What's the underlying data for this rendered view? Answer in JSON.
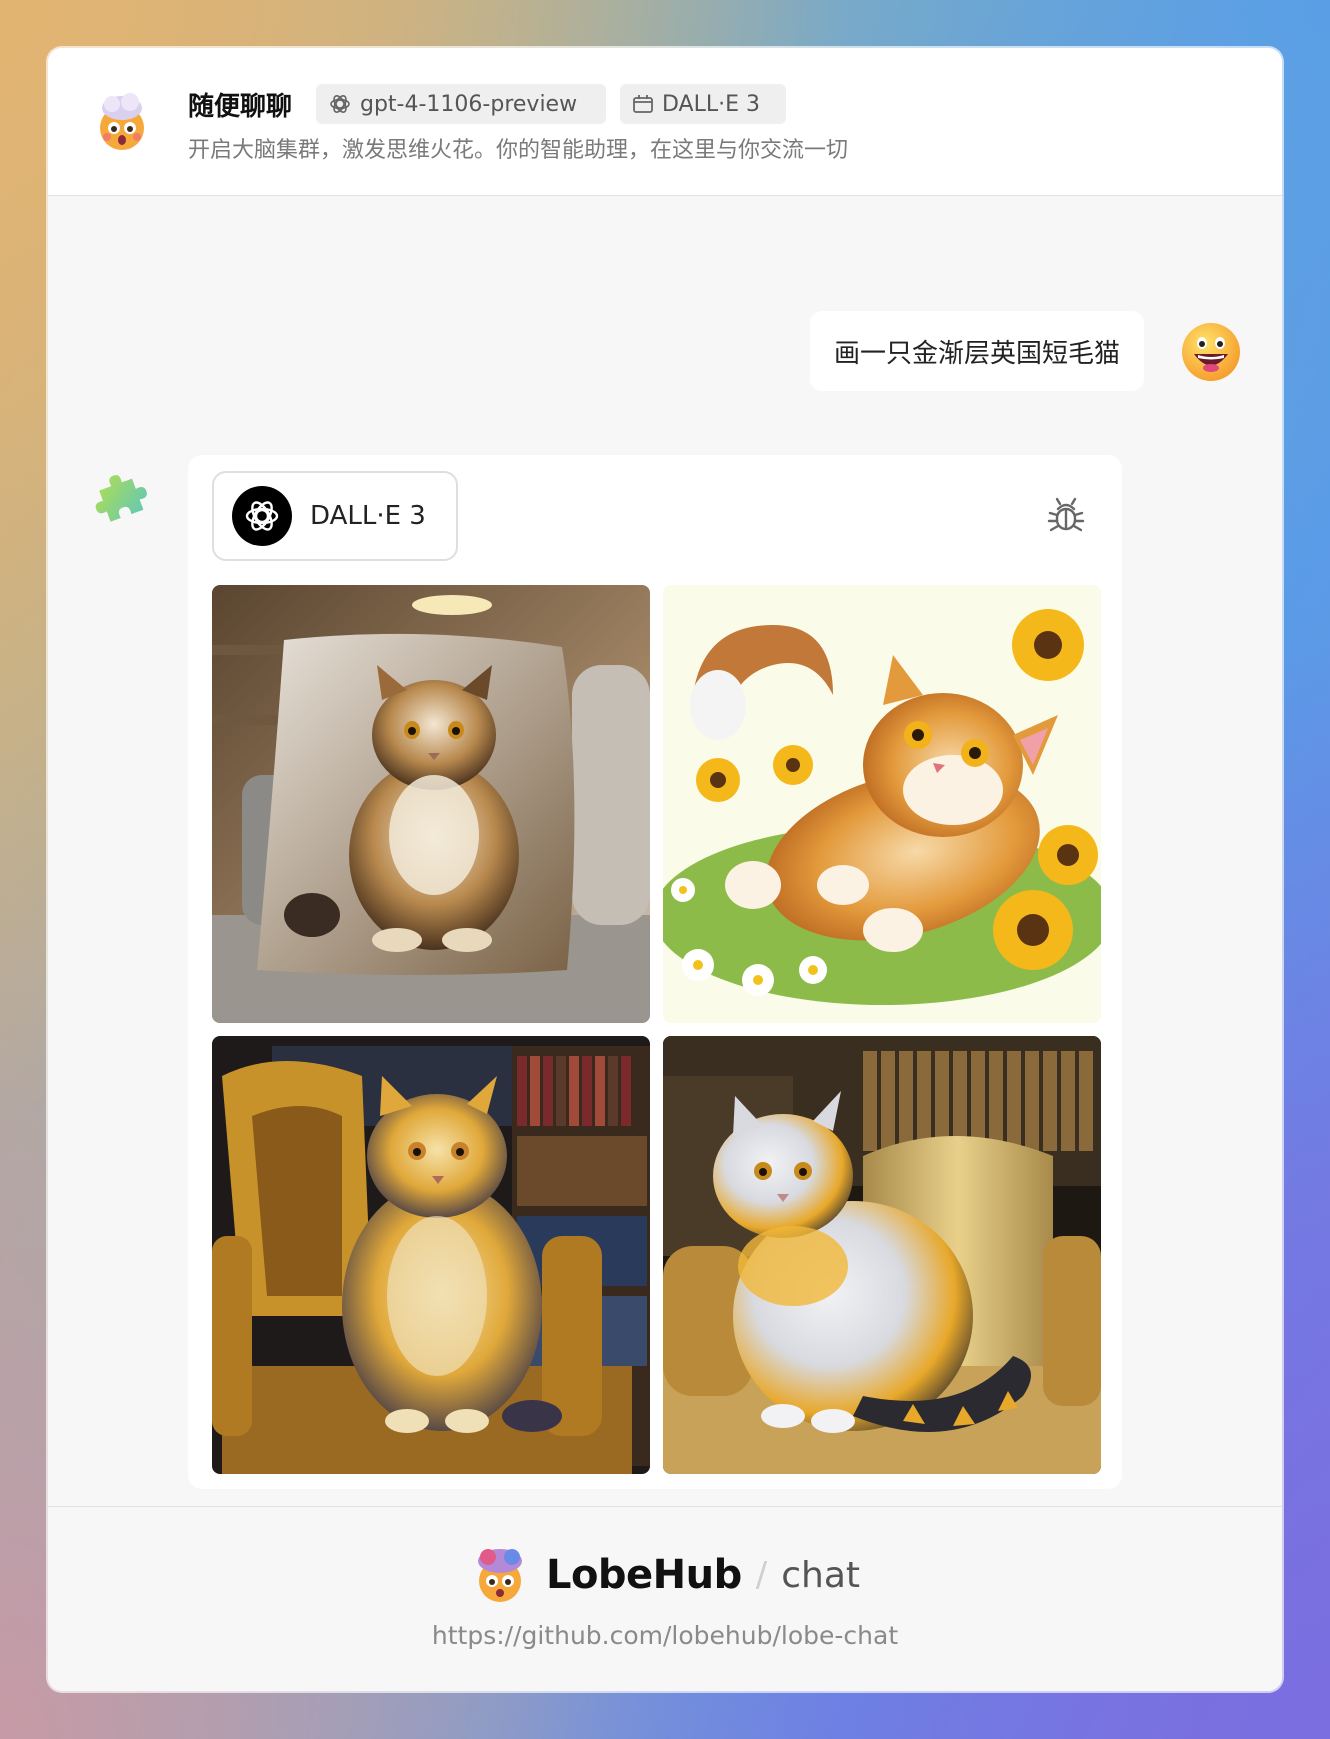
{
  "header": {
    "agent_name": "随便聊聊",
    "model_tag": "gpt-4-1106-preview",
    "plugin_tag": "DALL·E 3",
    "description": "开启大脑集群，激发思维火花。你的智能助理，在这里与你交流一切",
    "agent_avatar_icon": "exploding-head-emoji-icon"
  },
  "chat": {
    "user_message": "画一只金渐层英国短毛猫",
    "user_avatar_icon": "grinning-face-emoji-icon",
    "plugin_avatar_icon": "puzzle-piece-icon",
    "plugin_chip_label": "DALL·E 3",
    "plugin_chip_icon": "openai-logo-icon",
    "debug_icon": "bug-icon",
    "images": [
      {
        "subject": "cat-on-pillow"
      },
      {
        "subject": "cat-in-flowers"
      },
      {
        "subject": "cat-on-chair-library"
      },
      {
        "subject": "cat-on-armchair-library"
      }
    ]
  },
  "footer": {
    "brand_name": "LobeHub",
    "brand_separator": "/",
    "brand_sub": "chat",
    "url": "https://github.com/lobehub/lobe-chat"
  },
  "colors": {
    "card_bg": "#f7f7f7",
    "bubble_bg": "#ffffff",
    "tag_bg": "#efefef"
  }
}
